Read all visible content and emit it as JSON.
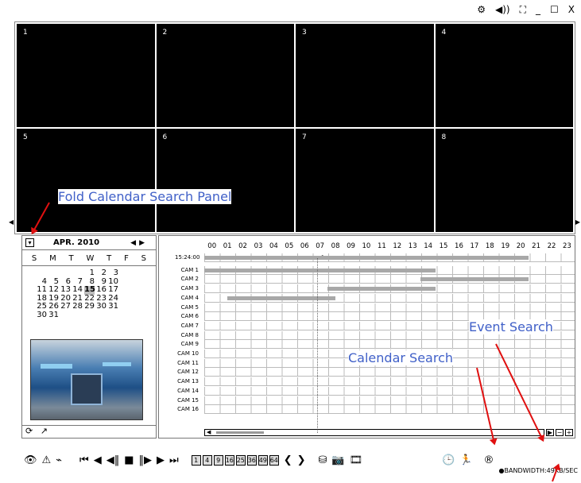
{
  "window_controls": [
    "⚙",
    "◀))",
    "⛶",
    "_",
    "☐",
    "X"
  ],
  "cameras_grid": [
    "1",
    "2",
    "3",
    "4",
    "5",
    "6",
    "7",
    "8"
  ],
  "calendar": {
    "month": "APR. 2010",
    "days_of_week": [
      "S",
      "M",
      "T",
      "W",
      "T",
      "F",
      "S"
    ],
    "weeks": [
      [
        "",
        "",
        "",
        "",
        "1",
        "2",
        "3"
      ],
      [
        "4",
        "5",
        "6",
        "7",
        "8",
        "9",
        "10"
      ],
      [
        "11",
        "12",
        "13",
        "14",
        "15",
        "16",
        "17"
      ],
      [
        "18",
        "19",
        "20",
        "21",
        "22",
        "23",
        "24"
      ],
      [
        "25",
        "26",
        "27",
        "28",
        "29",
        "30",
        "31"
      ],
      [
        "30",
        "31",
        "",
        "",
        "",
        "",
        ""
      ]
    ],
    "selected_day": "15"
  },
  "timeline": {
    "time_label": "15:24:00",
    "hours": [
      "00",
      "01",
      "02",
      "03",
      "04",
      "05",
      "06",
      "07",
      "08",
      "09",
      "10",
      "11",
      "12",
      "13",
      "14",
      "15",
      "16",
      "17",
      "18",
      "19",
      "20",
      "21",
      "22",
      "23"
    ],
    "cameras": [
      "CAM 1",
      "CAM 2",
      "CAM 3",
      "CAM 4",
      "CAM 5",
      "CAM 6",
      "CAM 7",
      "CAM 8",
      "CAM 9",
      "CAM 10",
      "CAM 11",
      "CAM 12",
      "CAM 13",
      "CAM 14",
      "CAM 15",
      "CAM 16"
    ],
    "recordings": [
      {
        "row": 0,
        "start": 0,
        "end": 21
      },
      {
        "row": 1,
        "start": 0,
        "end": 15
      },
      {
        "row": 2,
        "start": 14,
        "end": 21
      },
      {
        "row": 3,
        "start": 8,
        "end": 15
      },
      {
        "row": 4,
        "start": 1.5,
        "end": 8.5
      }
    ],
    "cursor_hour": 7.5
  },
  "toolbar": {
    "layout_buttons": [
      "1",
      "4",
      "9",
      "16",
      "25",
      "36",
      "49",
      "64"
    ],
    "bandwidth": "●BANDWIDTH:49KB/SEC"
  },
  "annotations": {
    "fold": "Fold Calendar Search Panel",
    "event": "Event Search",
    "calendar": "Calendar Search"
  },
  "colors": {
    "record_bar": "#a8a8a8",
    "annotation": "#4060c8",
    "arrow": "#e01010"
  }
}
